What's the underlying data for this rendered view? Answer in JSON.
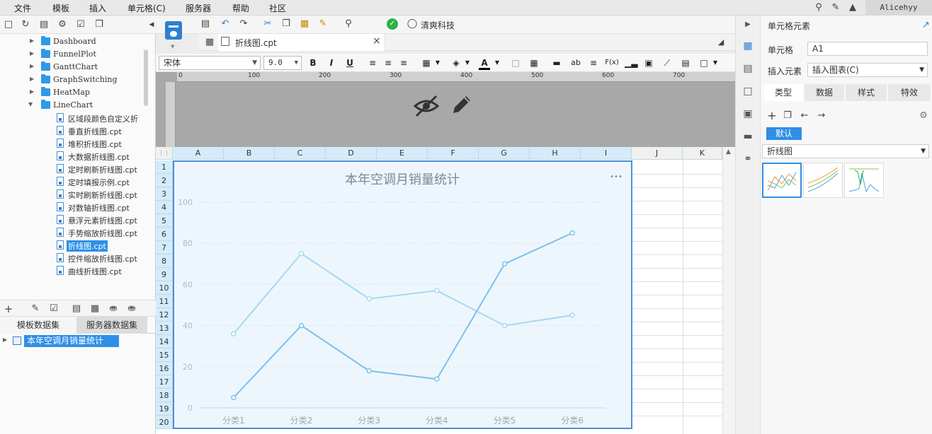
{
  "menu": [
    "文件",
    "模板",
    "插入",
    "单元格(C)",
    "服务器",
    "帮助",
    "社区"
  ],
  "user": "Alicehyy",
  "tree": {
    "folders": [
      {
        "label": "Dashboard",
        "expanded": false
      },
      {
        "label": "FunnelPlot",
        "expanded": false
      },
      {
        "label": "GanttChart",
        "expanded": false
      },
      {
        "label": "GraphSwitching",
        "expanded": false
      },
      {
        "label": "HeatMap",
        "expanded": false
      },
      {
        "label": "LineChart",
        "expanded": true
      }
    ],
    "files": [
      "区域段颜色自定义折",
      "垂直折线图.cpt",
      "堆积折线图.cpt",
      "大数据折线图.cpt",
      "定时刷新折线图.cpt",
      "定时填报示例.cpt",
      "实时刷新折线图.cpt",
      "对数轴折线图.cpt",
      "悬浮元素折线图.cpt",
      "手势缩放折线图.cpt",
      "折线图.cpt",
      "控件缩放折线图.cpt",
      "曲线折线图.cpt"
    ],
    "selected_file": "折线图.cpt"
  },
  "datasets": {
    "tab_template": "模板数据集",
    "tab_server": "服务器数据集",
    "item": "本年空调月销量统计"
  },
  "toolbar": {
    "brand": "清爽科技"
  },
  "file_tab": {
    "label": "折线图.cpt",
    "close": "×"
  },
  "format": {
    "font": "宋体",
    "size": "9.0",
    "bold": "B",
    "italic": "I",
    "underline": "U",
    "text_ab": "ab",
    "fx": "F(x)"
  },
  "ruler": {
    "marks": [
      "0",
      "100",
      "200",
      "300",
      "400",
      "500",
      "600",
      "700"
    ]
  },
  "grid": {
    "columns": [
      "A",
      "B",
      "C",
      "D",
      "E",
      "F",
      "G",
      "H",
      "I",
      "J",
      "K"
    ],
    "rows": [
      "1",
      "2",
      "3",
      "4",
      "5",
      "6",
      "7",
      "8",
      "9",
      "10",
      "11",
      "12",
      "13",
      "14",
      "15",
      "16",
      "17",
      "18",
      "19",
      "20"
    ]
  },
  "chart_data": {
    "type": "line",
    "title": "本年空调月销量统计",
    "categories": [
      "分类1",
      "分类2",
      "分类3",
      "分类4",
      "分类5",
      "分类6"
    ],
    "ylim": [
      0,
      100
    ],
    "yticks": [
      0,
      20,
      40,
      60,
      80,
      100
    ],
    "grid": true,
    "legend": "none",
    "series": [
      {
        "values": [
          36,
          75,
          53,
          57,
          40,
          45
        ],
        "color": "#a8d8f0"
      },
      {
        "values": [
          5,
          40,
          18,
          14,
          70,
          85
        ],
        "color": "#79c2ea"
      }
    ],
    "menu_dots": "•••"
  },
  "props": {
    "title": "单元格元素",
    "cell_label": "单元格",
    "cell_value": "A1",
    "insert_label": "插入元素",
    "insert_value": "插入图表(C)",
    "tabs": [
      "类型",
      "数据",
      "样式",
      "特效"
    ],
    "default_chip": "默认",
    "chart_type": "折线图"
  }
}
